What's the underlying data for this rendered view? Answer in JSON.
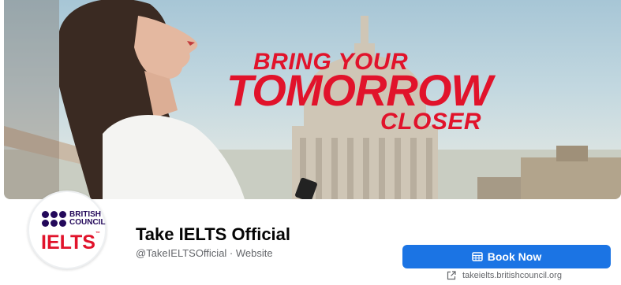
{
  "cover": {
    "headline_line1": "BRING YOUR",
    "headline_line2": "TOMORROW",
    "headline_line3": "CLOSER",
    "headline_color": "#e1132b"
  },
  "profile": {
    "logo_top": [
      "BRITISH",
      "COUNCIL"
    ],
    "logo_main": "IELTS",
    "logo_tm": "™",
    "name": "Take IELTS Official",
    "subtitle": "@TakeIELTSOfficial · Website"
  },
  "actions": {
    "primary_label": "Book Now",
    "primary_icon": "calendar-icon",
    "primary_color": "#1b74e4",
    "website_link": "takeielts.britishcouncil.org",
    "website_icon": "external-link-icon"
  }
}
